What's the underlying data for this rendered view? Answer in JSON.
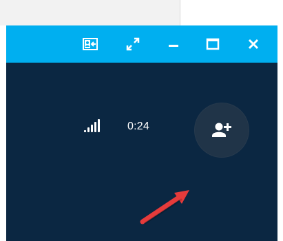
{
  "titlebar": {
    "icons": [
      "share-screen-icon",
      "fullscreen-icon",
      "minimize-icon",
      "maximize-icon",
      "close-icon"
    ]
  },
  "call": {
    "duration": "0:24",
    "signal_level": 1.0
  },
  "add_participant": {
    "icon": "add-person-icon"
  },
  "annotation": {
    "arrow_color": "#e63b3b"
  },
  "colors": {
    "titlebar": "#00aff0",
    "background": "#0b2742",
    "button_circle": "#203448",
    "foreground": "#ffffff"
  }
}
